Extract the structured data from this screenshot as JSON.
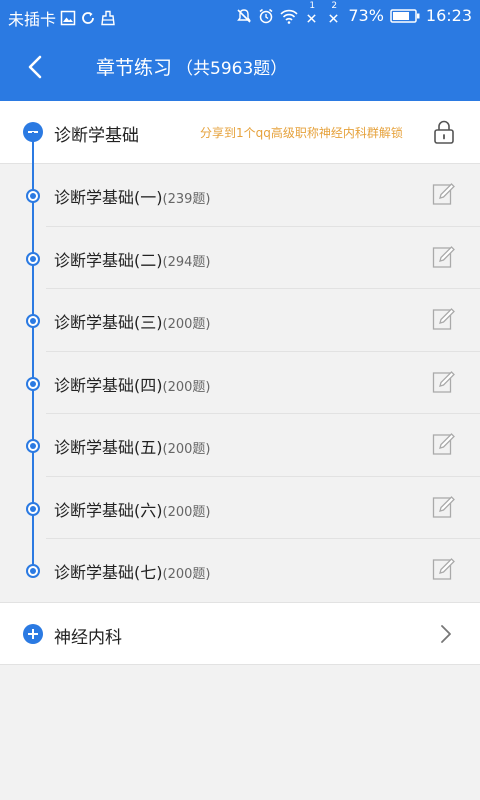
{
  "status_bar": {
    "carrier": "未插卡",
    "battery_percent": "73%",
    "time": "16:23",
    "sim1_label": "1",
    "sim2_label": "2"
  },
  "header": {
    "title": "章节练习",
    "total": "（共5963题）"
  },
  "sections": [
    {
      "name": "诊断学基础",
      "expanded": true,
      "unlock_tip": "分享到1个qq高级职称神经内科群解锁",
      "chapters": [
        {
          "title": "诊断学基础(一)",
          "count": "(239题)"
        },
        {
          "title": "诊断学基础(二)",
          "count": "(294题)"
        },
        {
          "title": "诊断学基础(三)",
          "count": "(200题)"
        },
        {
          "title": "诊断学基础(四)",
          "count": "(200题)"
        },
        {
          "title": "诊断学基础(五)",
          "count": "(200题)"
        },
        {
          "title": "诊断学基础(六)",
          "count": "(200题)"
        },
        {
          "title": "诊断学基础(七)",
          "count": "(200题)"
        }
      ]
    },
    {
      "name": "神经内科",
      "expanded": false
    }
  ],
  "colors": {
    "primary": "#2b7ae2",
    "tip": "#e6a23c",
    "background": "#f2f2f2"
  }
}
